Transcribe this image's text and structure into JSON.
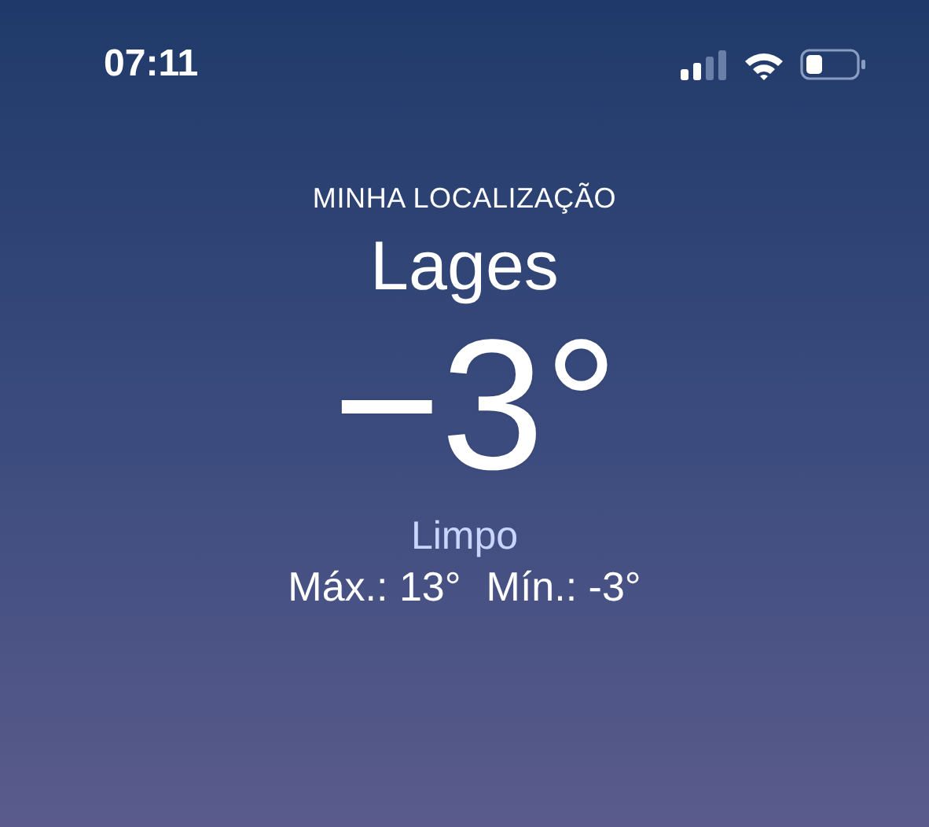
{
  "status_bar": {
    "time": "07:11"
  },
  "weather": {
    "location_label": "MINHA LOCALIZAÇÃO",
    "city": "Lages",
    "temperature": "−3°",
    "condition": "Limpo",
    "high": "Máx.: 13°",
    "low": "Mín.: -3°"
  }
}
